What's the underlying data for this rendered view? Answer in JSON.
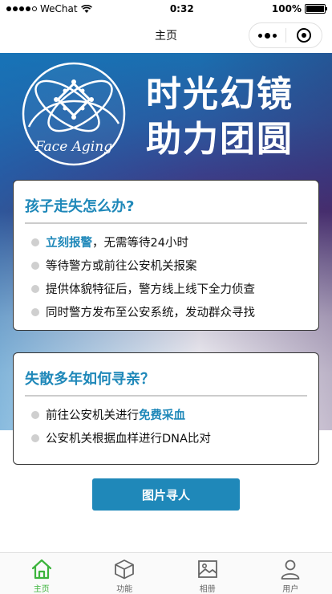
{
  "status_bar": {
    "carrier": "WeChat",
    "time": "0:32",
    "battery": "100%"
  },
  "nav": {
    "title": "主页"
  },
  "hero": {
    "logo_text": "Face Aging",
    "slogan_line1": "时光幻镜",
    "slogan_line2": "助力团圆"
  },
  "card1": {
    "title": "孩子走失怎么办?",
    "items": [
      {
        "highlight": "立刻报警",
        "text": "，无需等待24小时"
      },
      {
        "highlight": "",
        "text": "等待警方或前往公安机关报案"
      },
      {
        "highlight": "",
        "text": "提供体貌特征后，警方线上线下全力侦查"
      },
      {
        "highlight": "",
        "text": "同时警方发布至公安系统，发动群众寻找"
      }
    ]
  },
  "card2": {
    "title": "失散多年如何寻亲？",
    "items": [
      {
        "text": "前往公安机关进行",
        "highlight": "免费采血"
      },
      {
        "text": "公安机关根据血样进行DNA比对",
        "highlight": ""
      }
    ]
  },
  "action_button": {
    "label": "图片寻人"
  },
  "tabbar": {
    "items": [
      {
        "label": "主页",
        "icon": "home-icon",
        "active": true
      },
      {
        "label": "功能",
        "icon": "cube-icon",
        "active": false
      },
      {
        "label": "相册",
        "icon": "picture-icon",
        "active": false
      },
      {
        "label": "用户",
        "icon": "user-icon",
        "active": false
      }
    ]
  },
  "colors": {
    "accent": "#1f88b9",
    "tab_active": "#3cb43c"
  }
}
